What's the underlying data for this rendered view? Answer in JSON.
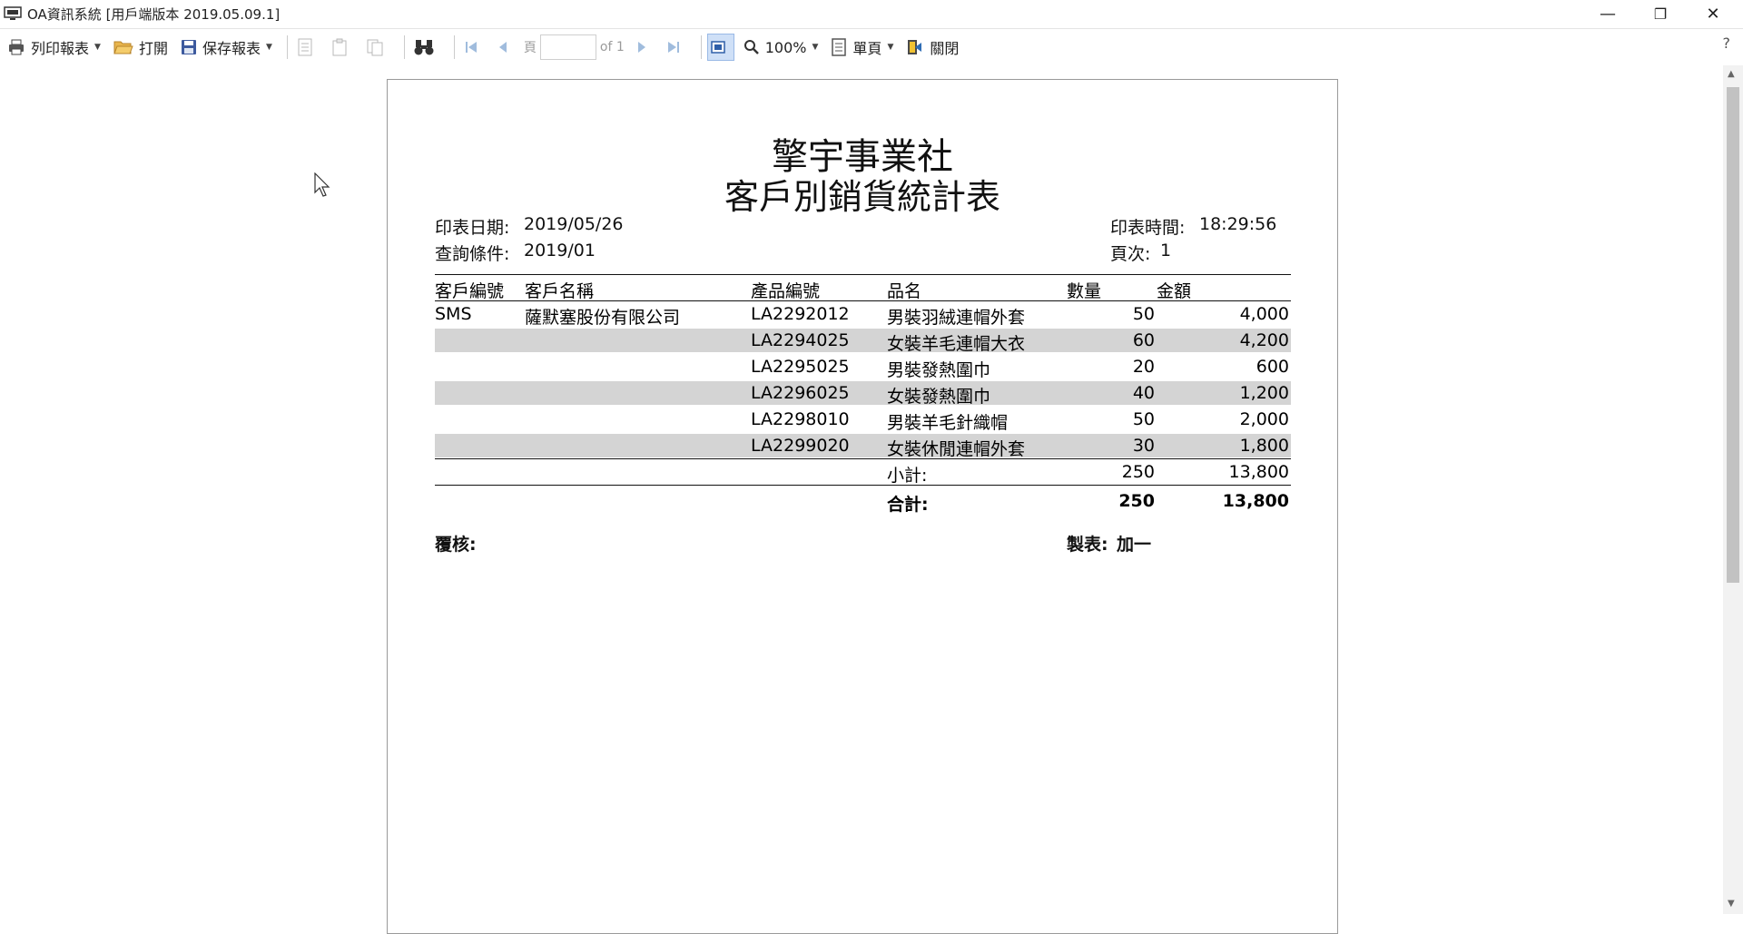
{
  "window": {
    "title": "OA資訊系統 [用戶端版本 2019.05.09.1]",
    "controls": {
      "minimize": "—",
      "restore": "❐",
      "close": "✕"
    }
  },
  "toolbar": {
    "print_label": "列印報表",
    "open_label": "打開",
    "save_label": "保存報表",
    "page_prefix": "頁",
    "page_value": "",
    "page_of": "of 1",
    "zoom_label": "100%",
    "layout_label": "單頁",
    "close_label": "關閉",
    "help_label": "?"
  },
  "report": {
    "company": "擎宇事業社",
    "title": "客戶別銷貨統計表",
    "print_date_label": "印表日期:",
    "print_date": "2019/05/26",
    "query_label": "查詢條件:",
    "query_value": "2019/01",
    "print_time_label": "印表時間:",
    "print_time": "18:29:56",
    "page_label": "頁次:",
    "page_value": "1",
    "headers": {
      "cust_no": "客戶編號",
      "cust_name": "客戶名稱",
      "prod_no": "產品編號",
      "prod_name": "品名",
      "qty": "數量",
      "amount": "金額"
    },
    "rows": [
      {
        "cust_no": "SMS",
        "cust_name": "薩默塞股份有限公司",
        "prod_no": "LA2292012",
        "prod_name": "男裝羽絨連帽外套",
        "qty": "50",
        "amount": "4,000"
      },
      {
        "cust_no": "",
        "cust_name": "",
        "prod_no": "LA2294025",
        "prod_name": "女裝羊毛連帽大衣",
        "qty": "60",
        "amount": "4,200"
      },
      {
        "cust_no": "",
        "cust_name": "",
        "prod_no": "LA2295025",
        "prod_name": "男裝發熱圍巾",
        "qty": "20",
        "amount": "600"
      },
      {
        "cust_no": "",
        "cust_name": "",
        "prod_no": "LA2296025",
        "prod_name": "女裝發熱圍巾",
        "qty": "40",
        "amount": "1,200"
      },
      {
        "cust_no": "",
        "cust_name": "",
        "prod_no": "LA2298010",
        "prod_name": "男裝羊毛針織帽",
        "qty": "50",
        "amount": "2,000"
      },
      {
        "cust_no": "",
        "cust_name": "",
        "prod_no": "LA2299020",
        "prod_name": "女裝休閒連帽外套",
        "qty": "30",
        "amount": "1,800"
      }
    ],
    "subtotal": {
      "label": "小計:",
      "qty": "250",
      "amount": "13,800"
    },
    "total": {
      "label": "合計:",
      "qty": "250",
      "amount": "13,800"
    },
    "review_label": "覆核:",
    "maker_label": "製表:",
    "maker_value": "加一"
  },
  "colors": {
    "row_shade": "#d4d4d4",
    "active_button": "#cfe0f7"
  }
}
